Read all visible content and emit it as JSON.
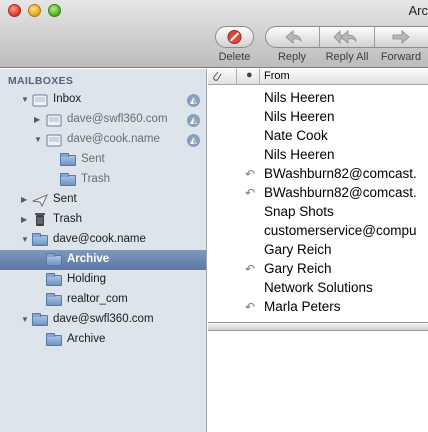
{
  "window": {
    "title": "Arc"
  },
  "toolbar": {
    "delete_label": "Delete",
    "reply_label": "Reply",
    "reply_all_label": "Reply All",
    "forward_label": "Forward"
  },
  "sidebar": {
    "header": "MAILBOXES",
    "items": [
      {
        "label": "Inbox",
        "icon": "inbox-icon"
      },
      {
        "label": "dave@swfl360.com",
        "icon": "inbox-icon"
      },
      {
        "label": "dave@cook.name",
        "icon": "inbox-icon"
      },
      {
        "label": "Sent",
        "icon": "folder-icon"
      },
      {
        "label": "Trash",
        "icon": "folder-icon"
      },
      {
        "label": "Sent",
        "icon": "sent-icon"
      },
      {
        "label": "Trash",
        "icon": "trash-icon"
      },
      {
        "label": "dave@cook.name",
        "icon": "folder-icon"
      },
      {
        "label": "Archive",
        "icon": "folder-icon"
      },
      {
        "label": "Holding",
        "icon": "folder-icon"
      },
      {
        "label": "realtor_com",
        "icon": "folder-icon"
      },
      {
        "label": "dave@swfl360.com",
        "icon": "folder-icon"
      },
      {
        "label": "Archive",
        "icon": "folder-icon"
      }
    ]
  },
  "message_list": {
    "columns": {
      "attachment": "attachment-icon",
      "status": "●",
      "from": "From"
    },
    "rows": [
      {
        "from": "Nils Heeren",
        "replied": false
      },
      {
        "from": "Nils Heeren",
        "replied": false
      },
      {
        "from": "Nate Cook",
        "replied": false
      },
      {
        "from": "Nils Heeren",
        "replied": false
      },
      {
        "from": "BWashburn82@comcast.",
        "replied": true
      },
      {
        "from": "BWashburn82@comcast.",
        "replied": true
      },
      {
        "from": "Snap Shots",
        "replied": false
      },
      {
        "from": "customerservice@compu",
        "replied": false
      },
      {
        "from": "Gary Reich",
        "replied": false
      },
      {
        "from": "Gary Reich",
        "replied": true
      },
      {
        "from": "Network Solutions",
        "replied": false
      },
      {
        "from": "Marla Peters",
        "replied": true
      }
    ]
  },
  "colors": {
    "sidebar_bg": "#dde4ec",
    "selection": "#6a86b0"
  }
}
